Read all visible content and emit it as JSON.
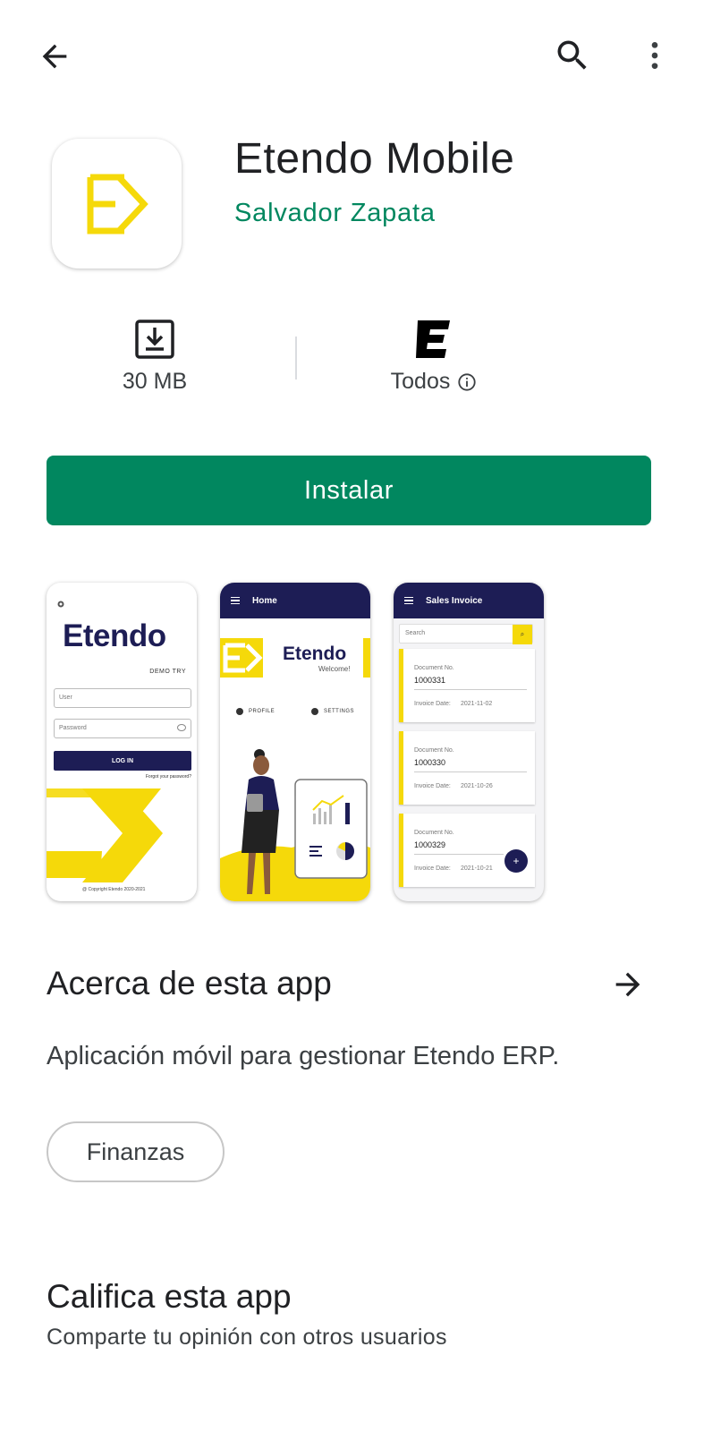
{
  "topbar": {
    "back_icon": "arrow-left-icon",
    "search_icon": "search-icon",
    "more_icon": "more-vert-icon"
  },
  "app": {
    "title": "Etendo Mobile",
    "developer": "Salvador Zapata",
    "icon_name": "etendo-logo-icon"
  },
  "stats": {
    "size_label": "30 MB",
    "rating_label": "Todos"
  },
  "install": {
    "label": "Instalar"
  },
  "screenshots": {
    "shot1": {
      "brand": "Etendo",
      "demo": "DEMO TRY",
      "user_placeholder": "User",
      "password_placeholder": "Password",
      "login": "LOG IN",
      "forgot": "Forgot your password?",
      "copyright": "@ Copyright Etendo 2020-2021"
    },
    "shot2": {
      "header": "Home",
      "brand": "Etendo",
      "welcome": "Welcome!",
      "profile": "PROFILE",
      "settings": "SETTINGS"
    },
    "shot3": {
      "header": "Sales Invoice",
      "search": "Search",
      "doc_label": "Document No.",
      "date_label": "Invoice Date:",
      "docs": [
        {
          "no": "1000331",
          "date": "2021-11-02"
        },
        {
          "no": "1000330",
          "date": "2021-10-26"
        },
        {
          "no": "1000329",
          "date": "2021-10-21"
        }
      ],
      "fab": "+"
    }
  },
  "about": {
    "title": "Acerca de esta app",
    "description": "Aplicación móvil para gestionar Etendo ERP.",
    "category": "Finanzas"
  },
  "rate": {
    "title": "Califica esta app",
    "subtitle": "Comparte tu opinión con otros usuarios"
  },
  "colors": {
    "accent": "#01875f",
    "brand_navy": "#1d1d55",
    "brand_yellow": "#f5d90a"
  }
}
